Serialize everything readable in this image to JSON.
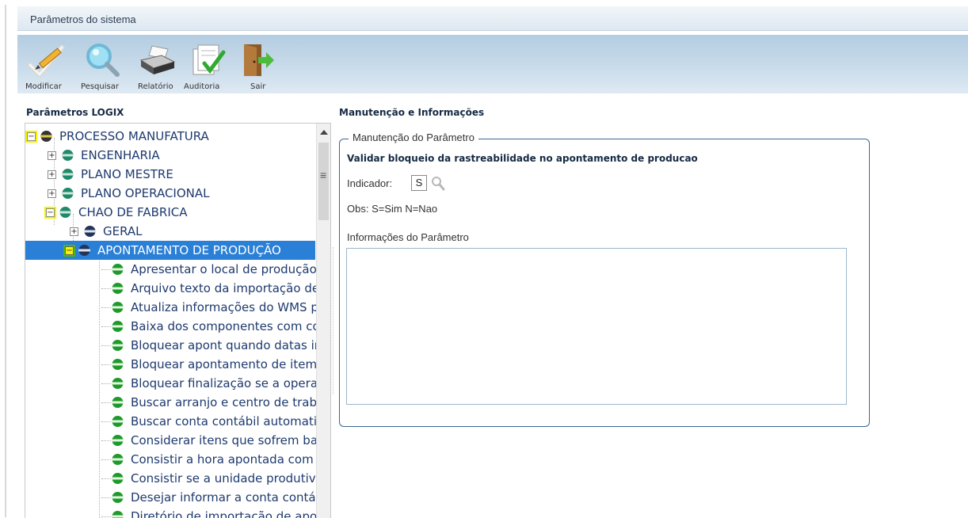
{
  "window": {
    "title": "Parâmetros do sistema"
  },
  "toolbar": {
    "modify": "Modificar",
    "search": "Pesquisar",
    "report": "Relatório",
    "audit": "Auditoria",
    "exit": "Sair"
  },
  "left_panel": {
    "title": "Parâmetros LOGIX"
  },
  "tree": {
    "root": "PROCESSO MANUFATURA",
    "engenharia": "ENGENHARIA",
    "plano_mestre": "PLANO MESTRE",
    "plano_operacional": "PLANO OPERACIONAL",
    "chao_fabrica": "CHAO DE FABRICA",
    "geral": "GERAL",
    "apontamento": "APONTAMENTO DE PRODUÇÃO",
    "items": [
      "Apresentar o local de produção",
      "Arquivo texto da importação de",
      "Atualiza informações do WMS p",
      "Baixa dos componentes com co",
      "Bloquear apont quando datas ir",
      "Bloquear apontamento de item",
      "Bloquear finalização se a operaç",
      "Buscar arranjo e centro de traba",
      "Buscar conta contábil automatic",
      "Considerar itens que sofrem bai",
      "Consistir a hora apontada com c",
      "Consistir se a unidade produtiva",
      "Desejar informar a conta contáb",
      "Diretório de importação de apo"
    ]
  },
  "right_panel": {
    "title": "Manutenção e Informações",
    "fieldset_legend": "Manutenção do Parâmetro",
    "param_description": "Validar bloqueio da rastreabilidade no apontamento de producao",
    "indicator_label": "Indicador:",
    "indicator_value": "S",
    "obs": "Obs: S=Sim N=Nao",
    "info_label": "Informações do Parâmetro",
    "info_text": ""
  },
  "colors": {
    "selection": "#2a7fd6",
    "highlight": "#f6f300",
    "toolbar": "#c8dbea",
    "panel_border": "#3a6690",
    "leaf_icon": "#1e9a2a"
  },
  "icons": {
    "modify": "pencil-check-icon",
    "search": "magnifier-icon",
    "report": "printer-icon",
    "audit": "checklist-icon",
    "exit": "door-exit-icon"
  }
}
